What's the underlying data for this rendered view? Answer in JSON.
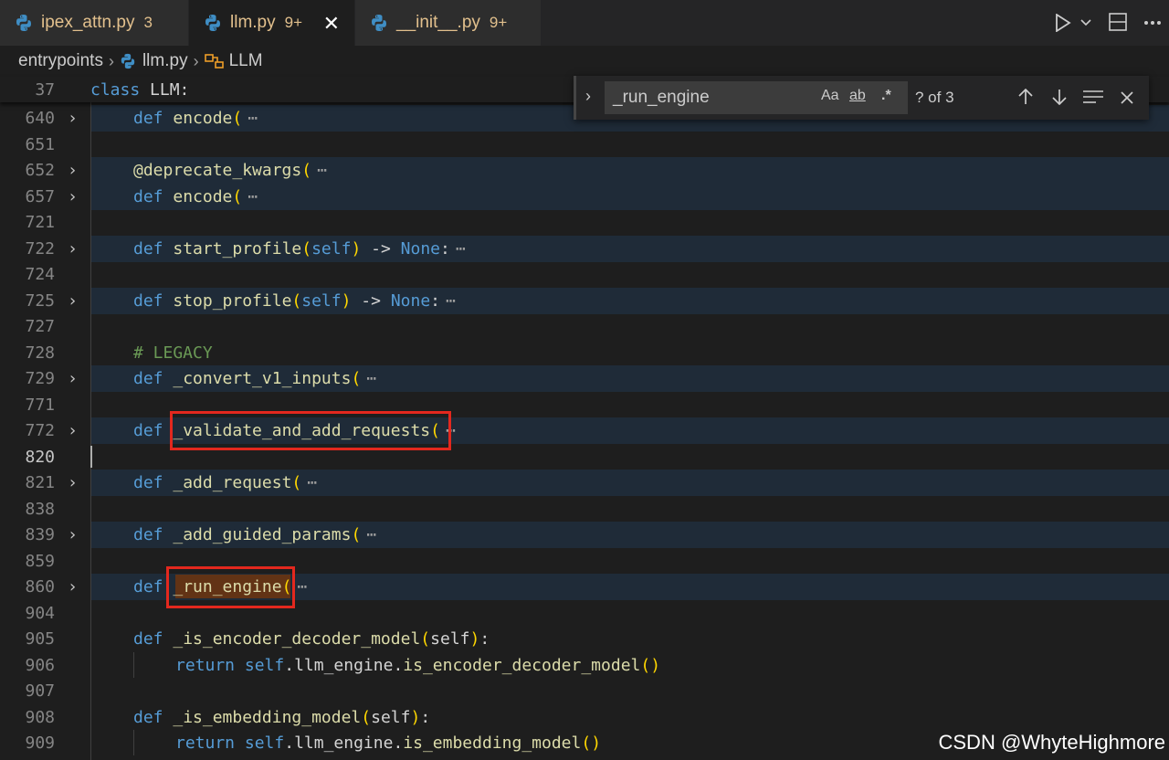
{
  "tabs": [
    {
      "name": "ipex_attn.py",
      "badge": "3"
    },
    {
      "name": "llm.py",
      "badge": "9+",
      "close": "✕"
    },
    {
      "name": "__init__.py",
      "badge": "9+"
    }
  ],
  "breadcrumb": {
    "folder": "entrypoints",
    "file": "llm.py",
    "symbol": "LLM"
  },
  "sticky": {
    "num": "37",
    "kw": "class",
    "name": "LLM:"
  },
  "find": {
    "query": "_run_engine",
    "case_label": "Aa",
    "word_label": "ab",
    "regex_label": ".*",
    "count": "? of 3"
  },
  "lines": [
    {
      "num": "640",
      "code_kw": "def",
      "code_name": "encode",
      "paren": "(",
      "rest": "",
      "ell": "⋯"
    },
    {
      "num": "651"
    },
    {
      "num": "652",
      "decorator": "@deprecate_kwargs",
      "paren": "(",
      "ell": "⋯"
    },
    {
      "num": "657",
      "code_kw": "def",
      "code_name": "encode",
      "paren": "(",
      "ell": "⋯"
    },
    {
      "num": "721"
    },
    {
      "num": "722",
      "code_kw": "def",
      "code_name": "start_profile",
      "sig_open": "(",
      "sig_self": "self",
      "sig_close": ")",
      "arrow": " -> ",
      "ret": "None",
      "colon": ":",
      "ell": "⋯"
    },
    {
      "num": "724"
    },
    {
      "num": "725",
      "code_kw": "def",
      "code_name": "stop_profile",
      "sig_open": "(",
      "sig_self": "self",
      "sig_close": ")",
      "arrow": " -> ",
      "ret": "None",
      "colon": ":",
      "ell": "⋯"
    },
    {
      "num": "727"
    },
    {
      "num": "728",
      "comment": "# LEGACY"
    },
    {
      "num": "729",
      "code_kw": "def",
      "code_name": "_convert_v1_inputs",
      "paren": "(",
      "ell": "⋯"
    },
    {
      "num": "771"
    },
    {
      "num": "772",
      "code_kw": "def",
      "code_name": "_validate_and_add_requests",
      "paren": "(",
      "ell": "⋯"
    },
    {
      "num": "820"
    },
    {
      "num": "821",
      "code_kw": "def",
      "code_name": "_add_request",
      "paren": "(",
      "ell": "⋯"
    },
    {
      "num": "838"
    },
    {
      "num": "839",
      "code_kw": "def",
      "code_name": "_add_guided_params",
      "paren": "(",
      "ell": "⋯"
    },
    {
      "num": "859"
    },
    {
      "num": "860",
      "code_kw": "def",
      "code_name": "_run_engine",
      "paren": "(",
      "ell": "⋯"
    },
    {
      "num": "904"
    },
    {
      "num": "905",
      "code_kw": "def",
      "code_name": "_is_encoder_decoder_model",
      "sig_open": "(",
      "sig_self": "self",
      "sig_close": ")",
      "colon": ":"
    },
    {
      "num": "906",
      "ret_kw": "return",
      "ret_self": "self",
      "ret_body": ".llm_engine.",
      "ret_fn": "is_encoder_decoder_model",
      "ret_parens": "()"
    },
    {
      "num": "907"
    },
    {
      "num": "908",
      "code_kw": "def",
      "code_name": "_is_embedding_model",
      "sig_open": "(",
      "sig_self": "self",
      "sig_close": ")",
      "colon": ":"
    },
    {
      "num": "909",
      "ret_kw": "return",
      "ret_self": "self",
      "ret_body": ".llm_engine.",
      "ret_fn": "is_embedding_model",
      "ret_parens": "()"
    }
  ],
  "watermark": "CSDN @WhyteHighmore",
  "colors": {
    "keyword": "#569cd6",
    "function": "#dcdcaa",
    "bracket": "#ffd700",
    "comment": "#6a9955",
    "highlight_box": "#e3281e",
    "match": "#623315"
  }
}
